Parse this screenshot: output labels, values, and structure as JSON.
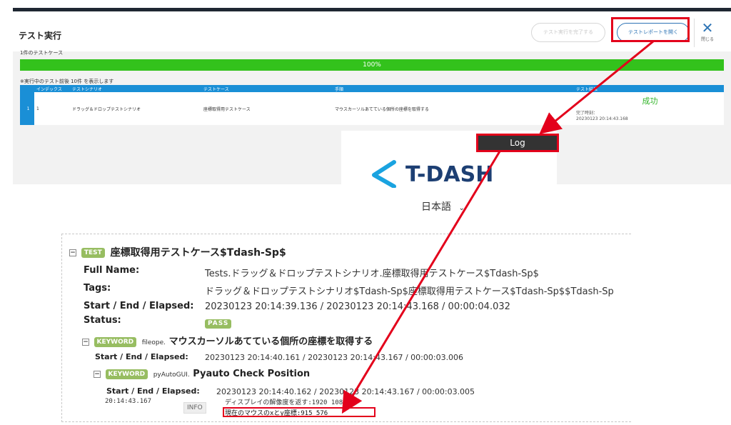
{
  "top_panel": {
    "title": "テスト実行",
    "complete_button": "テスト実行を完了する",
    "report_button": "テストレポートを開く",
    "close_label": "閉じる",
    "case_count": "1件のテストケース",
    "progress_percent": 100,
    "progress_label": "100%",
    "notice": "※実行中のテスト前後 10件 を表示します",
    "table": {
      "headers": [
        "インデックス",
        "テストシナリオ",
        "テストケース",
        "手順",
        "テスト結果"
      ],
      "row": {
        "row_number": "1",
        "index": "1",
        "scenario": "ドラッグ＆ドロップテストシナリオ",
        "test_case": "座標取得用テストケース",
        "step": "マウスカーソルあてている個所の座標を取得する",
        "result": "成功",
        "end_time_label": "完了時刻：",
        "end_time": "20230123 20:14:43.168"
      }
    }
  },
  "log_button": "Log",
  "logo": {
    "text": "T-DASH",
    "language": "日本語"
  },
  "log": {
    "test_badge": "TEST",
    "test_name": "座標取得用テストケース$Tdash-Sp$",
    "full_name_label": "Full Name:",
    "full_name": "Tests.ドラッグ＆ドロップテストシナリオ.座標取得用テストケース$Tdash-Sp$",
    "tags_label": "Tags:",
    "tags": "ドラッグ＆ドロップテストシナリオ$Tdash-Sp$座標取得用テストケース$Tdash-Sp$$Tdash-Sp",
    "elapsed_label": "Start / End / Elapsed:",
    "test_elapsed": "20230123 20:14:39.136 / 20230123 20:14:43.168 / 00:00:04.032",
    "status_label": "Status:",
    "status": "PASS",
    "keyword_badge": "KEYWORD",
    "kw1_lib": "fileope",
    "kw1_name": "マウスカーソルあてている個所の座標を取得する",
    "kw1_elapsed": "20230123 20:14:40.161 / 20230123 20:14:43.167 / 00:00:03.006",
    "kw2_lib": "pyAutoGUI",
    "kw2_name": "Pyauto Check Position",
    "kw2_elapsed": "20230123 20:14:40.162 / 20230123 20:14:43.167 / 00:00:03.005",
    "msg_time": "20:14:43.167",
    "msg_level": "INFO",
    "msg_line1": "ディスプレイの解像度を返す:1920 1080",
    "msg_line2": "現在のマウスのxとy座標:915 576"
  },
  "colors": {
    "accent_blue": "#1a8fd6",
    "progress_green": "#33c21c",
    "badge_green": "#97bd61",
    "annotation_red": "#e3001b",
    "logo_navy": "#1d3f73"
  }
}
